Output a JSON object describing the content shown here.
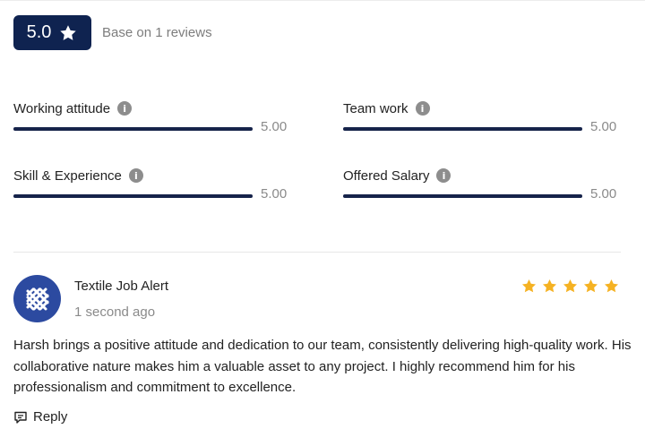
{
  "summary": {
    "score": "5.0",
    "base_text": "Base on 1 reviews",
    "star_icon": "star-icon"
  },
  "ratings": [
    {
      "label": "Working attitude",
      "value": "5.00",
      "fraction": 1.0
    },
    {
      "label": "Team work",
      "value": "5.00",
      "fraction": 1.0
    },
    {
      "label": "Skill & Experience",
      "value": "5.00",
      "fraction": 1.0
    },
    {
      "label": "Offered Salary",
      "value": "5.00",
      "fraction": 1.0
    }
  ],
  "review": {
    "reviewer": "Textile Job Alert",
    "time": "1 second ago",
    "stars": 5,
    "text": "Harsh brings a positive attitude and dedication to our team, consistently delivering high-quality work. His collaborative nature makes him a valuable asset to any project. I highly recommend him for his professionalism and commitment to excellence.",
    "reply_label": "Reply"
  },
  "colors": {
    "badge": "#0f2350",
    "bar_fill": "#16234a",
    "star": "#f5b223",
    "avatar": "#2c4aa0"
  }
}
